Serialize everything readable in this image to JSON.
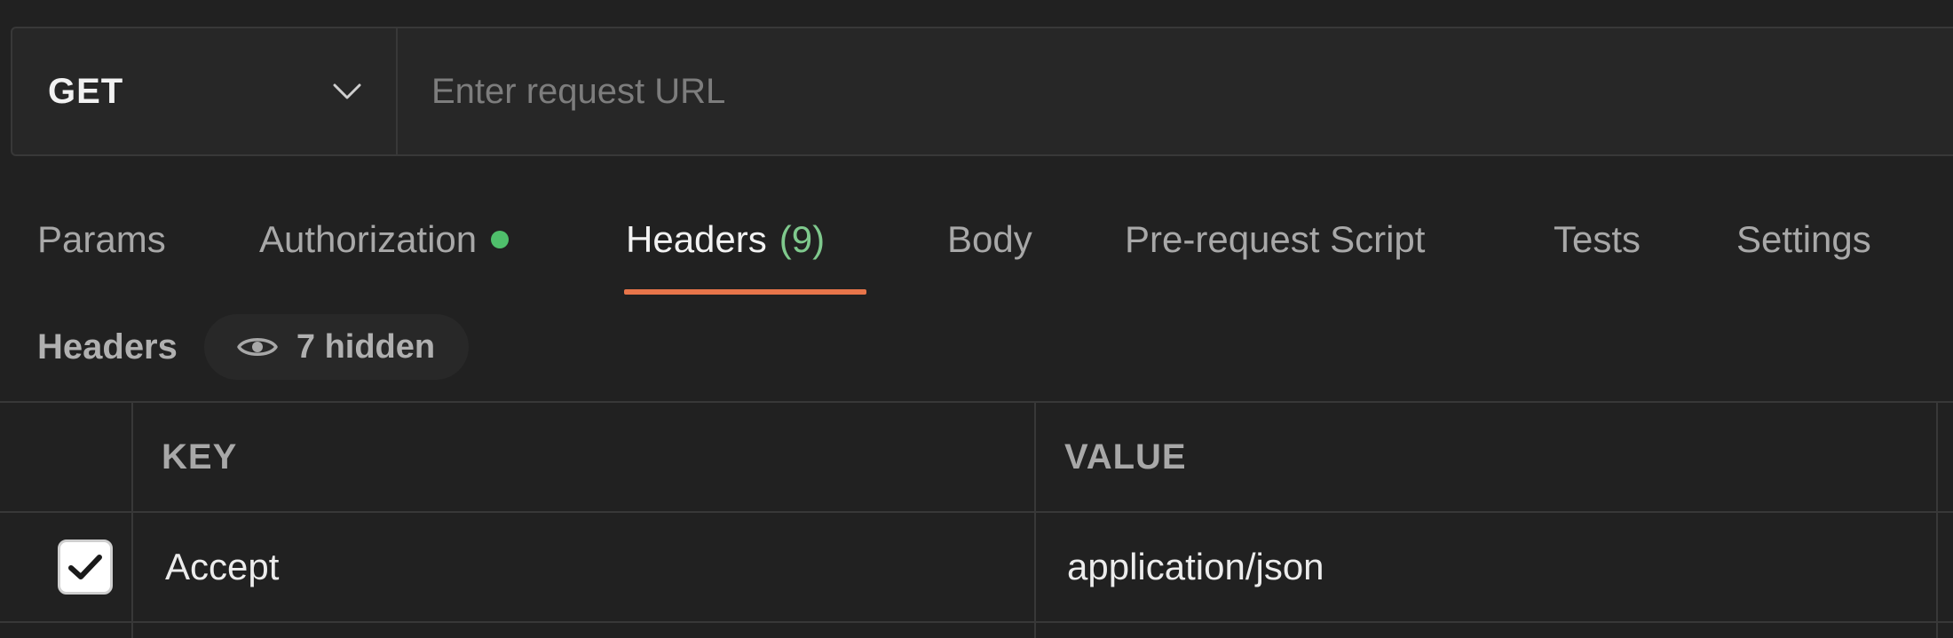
{
  "request": {
    "method": "GET",
    "url_placeholder": "Enter request URL",
    "url_value": ""
  },
  "tabs": [
    {
      "label": "Params"
    },
    {
      "label": "Authorization",
      "status_dot": true
    },
    {
      "label": "Headers",
      "count": "(9)",
      "active": true
    },
    {
      "label": "Body"
    },
    {
      "label": "Pre-request Script"
    },
    {
      "label": "Tests"
    },
    {
      "label": "Settings"
    }
  ],
  "headers_section": {
    "title": "Headers",
    "hidden_toggle": {
      "icon": "eye-icon",
      "label": "7 hidden"
    }
  },
  "table": {
    "columns": [
      "KEY",
      "VALUE"
    ],
    "rows": [
      {
        "checked": true,
        "key": "Accept",
        "value": "application/json"
      }
    ]
  },
  "colors": {
    "background": "#212121",
    "active_tab_underline": "#e8754a",
    "status_dot": "#4fbf6b",
    "count_text": "#7fc98d"
  }
}
